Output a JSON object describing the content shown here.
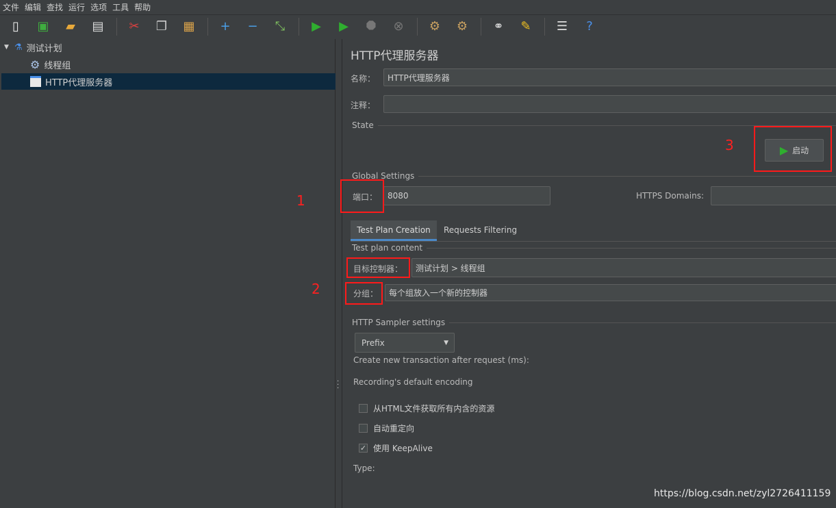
{
  "menu": [
    "文件",
    "编辑",
    "查找",
    "运行",
    "选项",
    "工具",
    "帮助"
  ],
  "toolbar": [
    {
      "name": "new-icon",
      "glyph": "▯",
      "color": "#f0f0f0"
    },
    {
      "name": "templates-icon",
      "glyph": "▣",
      "color": "#3fae3f"
    },
    {
      "name": "open-icon",
      "glyph": "▰",
      "color": "#e8a93a"
    },
    {
      "name": "save-icon",
      "glyph": "▤",
      "color": "#dddddd"
    },
    {
      "sep": true
    },
    {
      "name": "cut-icon",
      "glyph": "✂",
      "color": "#e04040"
    },
    {
      "name": "copy-icon",
      "glyph": "❐",
      "color": "#cccccc"
    },
    {
      "name": "paste-icon",
      "glyph": "▦",
      "color": "#d9a24a"
    },
    {
      "sep": true
    },
    {
      "name": "expand-icon",
      "glyph": "+",
      "color": "#4a9fe8"
    },
    {
      "name": "collapse-icon",
      "glyph": "−",
      "color": "#4a9fe8"
    },
    {
      "name": "toggle-icon",
      "glyph": "⤡",
      "color": "#7fbf5f"
    },
    {
      "sep": true
    },
    {
      "name": "start-icon",
      "glyph": "▶",
      "color": "#2fae2f"
    },
    {
      "name": "start-no-pauses-icon",
      "glyph": "▶",
      "color": "#2fae2f"
    },
    {
      "name": "stop-icon",
      "glyph": "⯃",
      "color": "#777777"
    },
    {
      "name": "shutdown-icon",
      "glyph": "⊗",
      "color": "#777777"
    },
    {
      "sep": true
    },
    {
      "name": "clear-icon",
      "glyph": "⚙",
      "color": "#c8a060"
    },
    {
      "name": "clear-all-icon",
      "glyph": "⚙",
      "color": "#c8a060"
    },
    {
      "sep": true
    },
    {
      "name": "search-icon",
      "glyph": "⚭",
      "color": "#dddddd"
    },
    {
      "name": "reset-search-icon",
      "glyph": "✎",
      "color": "#f0c020"
    },
    {
      "sep": true
    },
    {
      "name": "function-helper-icon",
      "glyph": "☰",
      "color": "#dddddd"
    },
    {
      "name": "help-icon",
      "glyph": "?",
      "color": "#4a8fe8"
    }
  ],
  "tree": {
    "root": "测试计划",
    "children": [
      "线程组",
      "HTTP代理服务器"
    ]
  },
  "panel": {
    "title": "HTTP代理服务器",
    "name_label": "名称：",
    "name_value": "HTTP代理服务器",
    "comment_label": "注释：",
    "comment_value": "",
    "state_legend": "State",
    "start_button": "启动",
    "global_legend": "Global Settings",
    "port_label": "端口：",
    "port_value": "8080",
    "https_label": "HTTPS Domains:",
    "https_value": "",
    "tabs": [
      "Test Plan Creation",
      "Requests Filtering"
    ],
    "active_tab": "Test Plan Creation",
    "content_legend": "Test plan content",
    "target_label": "目标控制器：",
    "target_value": "测试计划 > 线程组",
    "group_label": "分组：",
    "group_value": "每个组放入一个新的控制器",
    "sampler_legend": "HTTP Sampler settings",
    "prefix_value": "Prefix",
    "transaction_label": "Create new transaction after request (ms):",
    "encoding_label": "Recording's default encoding",
    "checkboxes": [
      {
        "label": "从HTML文件获取所有内含的资源",
        "checked": false
      },
      {
        "label": "自动重定向",
        "checked": false
      },
      {
        "label": "使用 KeepAlive",
        "checked": true
      }
    ],
    "type_label": "Type:"
  },
  "annotations": [
    "1",
    "2",
    "3"
  ],
  "watermark": "https://blog.csdn.net/zyl2726411159",
  "colors": {
    "background": "#3c3f41",
    "selection": "#0d293e",
    "annotation": "#ff1a1a",
    "tab_underline": "#4a88c7"
  }
}
